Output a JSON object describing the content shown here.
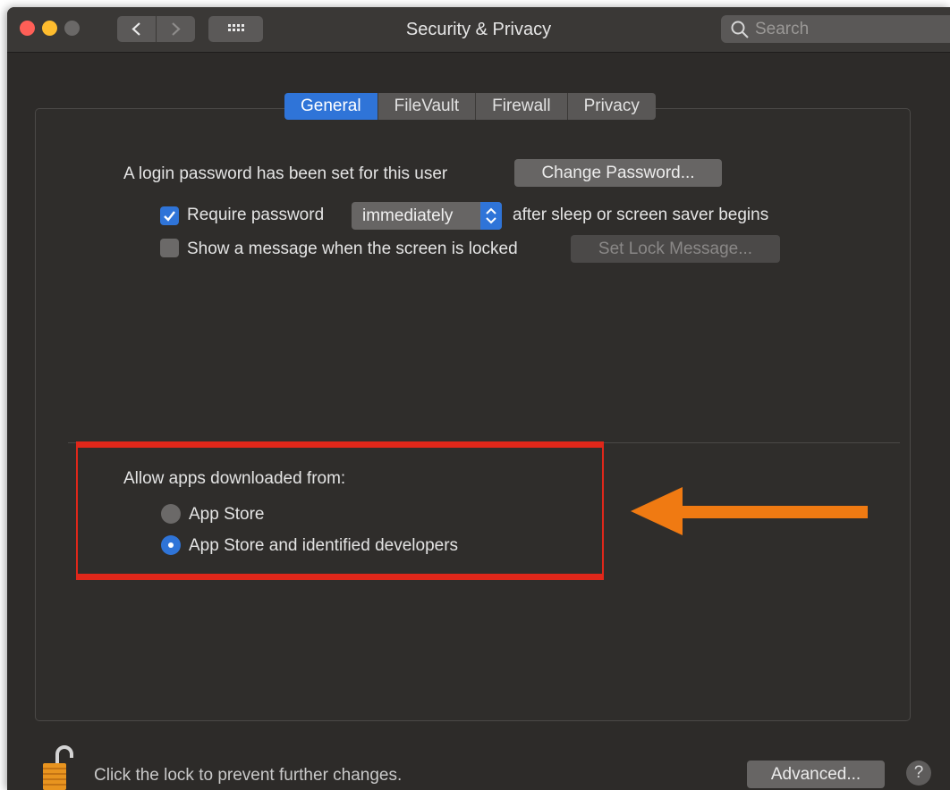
{
  "window": {
    "title": "Security & Privacy"
  },
  "search": {
    "placeholder": "Search"
  },
  "tabs": [
    {
      "label": "General",
      "selected": true
    },
    {
      "label": "FileVault",
      "selected": false
    },
    {
      "label": "Firewall",
      "selected": false
    },
    {
      "label": "Privacy",
      "selected": false
    }
  ],
  "general": {
    "login_text": "A login password has been set for this user",
    "change_password_label": "Change Password...",
    "require_password": {
      "label": "Require password",
      "checked": true,
      "value": "immediately",
      "suffix": "after sleep or screen saver begins"
    },
    "show_message": {
      "label": "Show a message when the screen is locked",
      "checked": false,
      "button_label": "Set Lock Message..."
    },
    "allow_apps": {
      "heading": "Allow apps downloaded from:",
      "options": [
        {
          "label": "App Store",
          "selected": false
        },
        {
          "label": "App Store and identified developers",
          "selected": true
        }
      ]
    }
  },
  "footer": {
    "lock_text": "Click the lock to prevent further changes.",
    "advanced_label": "Advanced...",
    "help_label": "?"
  },
  "colors": {
    "accent": "#2f74d8",
    "highlight_box": "#e0271a",
    "annotation_arrow": "#f07a12"
  }
}
